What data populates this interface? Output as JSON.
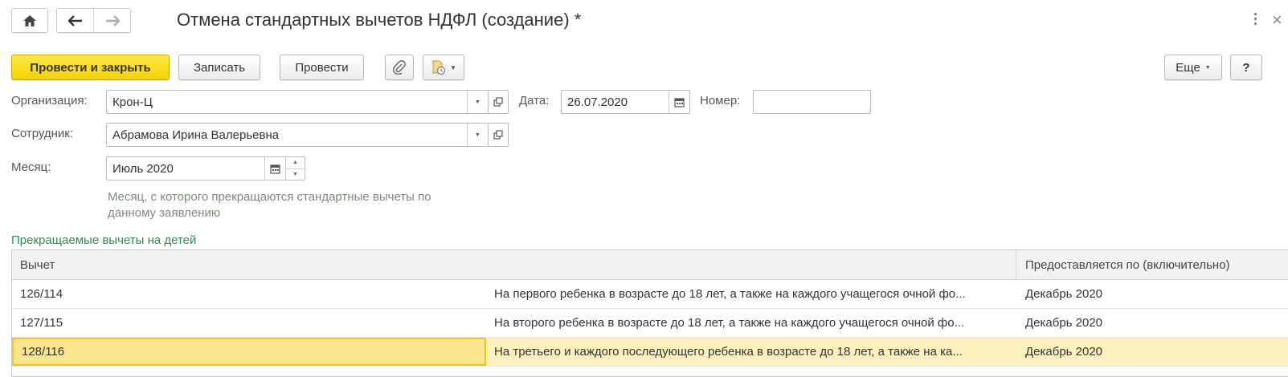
{
  "window": {
    "title": "Отмена стандартных вычетов НДФЛ (создание) *",
    "icons": {
      "home": "home-icon",
      "back": "arrow-left-icon",
      "forward": "arrow-right-icon",
      "menu": "kebab-menu-icon",
      "close": "close-icon"
    }
  },
  "toolbar": {
    "post_and_close": "Провести и закрыть",
    "save": "Записать",
    "post": "Провести",
    "attach_icon": "paperclip-icon",
    "report_icon": "document-report-icon",
    "more": "Еще",
    "help": "?"
  },
  "form": {
    "organization": {
      "label": "Организация:",
      "value": "Крон-Ц"
    },
    "date": {
      "label": "Дата:",
      "value": "26.07.2020"
    },
    "number": {
      "label": "Номер:",
      "value": ""
    },
    "employee": {
      "label": "Сотрудник:",
      "value": "Абрамова Ирина Валерьевна"
    },
    "month": {
      "label": "Месяц:",
      "value": "Июль 2020",
      "hint": "Месяц, с которого прекращаются стандартные вычеты по данному заявлению"
    }
  },
  "deductions": {
    "section_title": "Прекращаемые вычеты на детей",
    "columns": [
      "Вычет",
      "Предоставляется по (включительно)"
    ],
    "rows": [
      {
        "code": "126/114",
        "description": "На первого ребенка в возрасте до 18 лет, а также на каждого учащегося очной фо...",
        "until": "Декабрь 2020"
      },
      {
        "code": "127/115",
        "description": "На второго ребенка в возрасте до 18 лет, а также на каждого учащегося очной фо...",
        "until": "Декабрь 2020"
      },
      {
        "code": "128/116",
        "description": "На третьего и каждого последующего ребенка в возрасте до 18 лет, а также на ка...",
        "until": "Декабрь 2020"
      }
    ],
    "selected_row": 2
  },
  "colors": {
    "primary_button": "#f5d300",
    "section_title": "#2e8b57",
    "selected_row": "#fdf4cc",
    "hint_text": "#7d8a7b"
  }
}
